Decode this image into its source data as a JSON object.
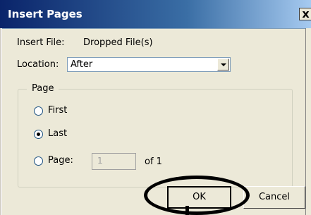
{
  "window": {
    "title": "Insert Pages",
    "close_glyph": "x"
  },
  "insert_file": {
    "label": "Insert File:",
    "value": "Dropped File(s)"
  },
  "location": {
    "label": "Location:",
    "selected": "After"
  },
  "page_group": {
    "title": "Page",
    "options": [
      {
        "label": "First",
        "checked": false
      },
      {
        "label": "Last",
        "checked": true
      },
      {
        "label": "Page:",
        "checked": false
      }
    ],
    "page_number": "1",
    "of_text": "of 1"
  },
  "buttons": {
    "ok": "OK",
    "cancel": "Cancel"
  }
}
